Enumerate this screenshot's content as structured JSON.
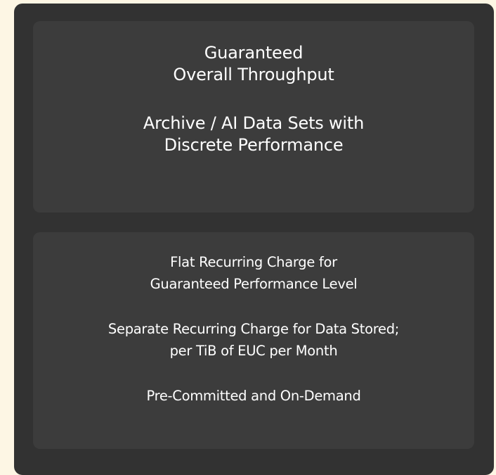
{
  "performance_card": {
    "lines_group_1": [
      "Guaranteed",
      "Overall Throughput"
    ],
    "lines_group_2": [
      "Archive / AI Data Sets with",
      "Discrete Performance"
    ]
  },
  "pricing_card": {
    "lines_group_1": [
      "Flat Recurring Charge for",
      "Guaranteed Performance Level"
    ],
    "lines_group_2": [
      "Separate Recurring Charge for Data Stored;",
      "per TiB of EUC per Month"
    ],
    "lines_group_3": [
      "Pre-Committed and On-Demand"
    ]
  }
}
